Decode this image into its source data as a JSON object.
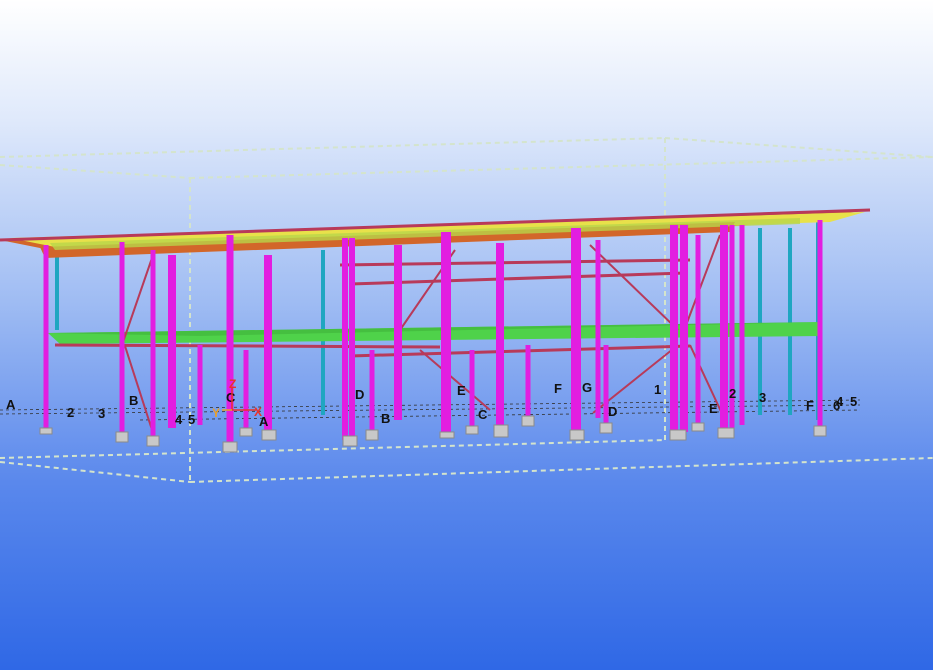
{
  "viewport": {
    "grid_labels_left": [
      "A",
      "2",
      "3",
      "B",
      "4",
      "5",
      "C",
      "A"
    ],
    "grid_labels_mid": [
      "D",
      "B",
      "E",
      "C",
      "F",
      "G",
      "D"
    ],
    "grid_labels_right": [
      "1",
      "E",
      "2",
      "3",
      "F",
      "4",
      "5",
      "6"
    ],
    "axis": {
      "z": "Z",
      "y": "Y",
      "x": "X"
    },
    "colors": {
      "column": "#e21ee0",
      "column_secondary": "#1fa6c1",
      "beam": "#b83a5a",
      "roof_slab": "#e8e14a",
      "floor_slab": "#4fd24a",
      "roof_beam": "#d2662a",
      "work_area_box": "#d8e6d2"
    }
  }
}
